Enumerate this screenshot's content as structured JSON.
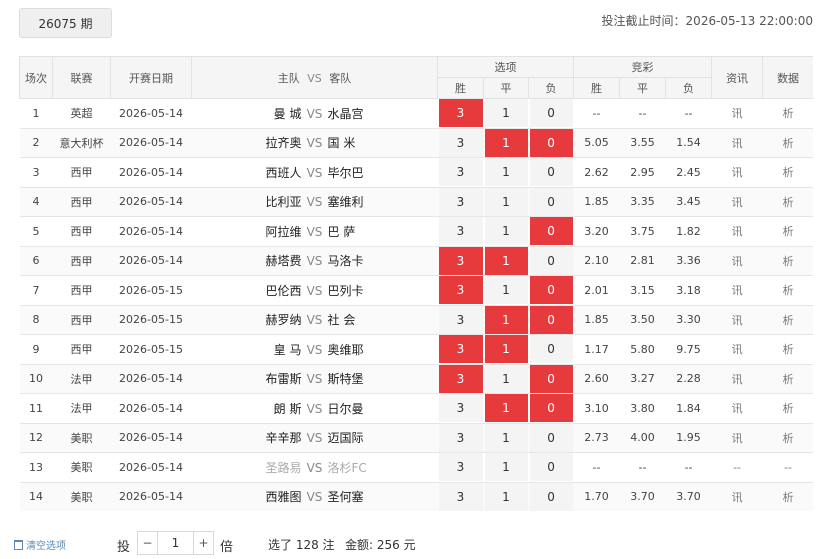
{
  "issue": "26075 期",
  "deadline": "投注截止时间：2026-05-13 22:00:00",
  "headers": {
    "no": "场次",
    "league": "联赛",
    "date": "开赛日期",
    "home": "主队",
    "vs": "VS",
    "away": "客队",
    "options": "选项",
    "odds": "竞彩",
    "win": "胜",
    "draw": "平",
    "lose": "负",
    "info": "资讯",
    "data": "数据"
  },
  "rows": [
    {
      "no": "1",
      "league": "英超",
      "date": "2026-05-14",
      "home": "曼 城",
      "away": "水晶宫",
      "p": [
        "3",
        "1",
        "0"
      ],
      "sel": [
        true,
        false,
        false
      ],
      "odds": [
        "--",
        "--",
        "--"
      ],
      "info": "讯",
      "data": "析",
      "disabled": false
    },
    {
      "no": "2",
      "league": "意大利杯",
      "date": "2026-05-14",
      "home": "拉齐奥",
      "away": "国 米",
      "p": [
        "3",
        "1",
        "0"
      ],
      "sel": [
        false,
        true,
        true
      ],
      "odds": [
        "5.05",
        "3.55",
        "1.54"
      ],
      "info": "讯",
      "data": "析",
      "disabled": false
    },
    {
      "no": "3",
      "league": "西甲",
      "date": "2026-05-14",
      "home": "西班人",
      "away": "毕尔巴",
      "p": [
        "3",
        "1",
        "0"
      ],
      "sel": [
        false,
        false,
        false
      ],
      "odds": [
        "2.62",
        "2.95",
        "2.45"
      ],
      "info": "讯",
      "data": "析",
      "disabled": false
    },
    {
      "no": "4",
      "league": "西甲",
      "date": "2026-05-14",
      "home": "比利亚",
      "away": "塞维利",
      "p": [
        "3",
        "1",
        "0"
      ],
      "sel": [
        false,
        false,
        false
      ],
      "odds": [
        "1.85",
        "3.35",
        "3.45"
      ],
      "info": "讯",
      "data": "析",
      "disabled": false
    },
    {
      "no": "5",
      "league": "西甲",
      "date": "2026-05-14",
      "home": "阿拉维",
      "away": "巴 萨",
      "p": [
        "3",
        "1",
        "0"
      ],
      "sel": [
        false,
        false,
        true
      ],
      "odds": [
        "3.20",
        "3.75",
        "1.82"
      ],
      "info": "讯",
      "data": "析",
      "disabled": false
    },
    {
      "no": "6",
      "league": "西甲",
      "date": "2026-05-14",
      "home": "赫塔费",
      "away": "马洛卡",
      "p": [
        "3",
        "1",
        "0"
      ],
      "sel": [
        true,
        true,
        false
      ],
      "odds": [
        "2.10",
        "2.81",
        "3.36"
      ],
      "info": "讯",
      "data": "析",
      "disabled": false
    },
    {
      "no": "7",
      "league": "西甲",
      "date": "2026-05-15",
      "home": "巴伦西",
      "away": "巴列卡",
      "p": [
        "3",
        "1",
        "0"
      ],
      "sel": [
        true,
        false,
        true
      ],
      "odds": [
        "2.01",
        "3.15",
        "3.18"
      ],
      "info": "讯",
      "data": "析",
      "disabled": false
    },
    {
      "no": "8",
      "league": "西甲",
      "date": "2026-05-15",
      "home": "赫罗纳",
      "away": "社 会",
      "p": [
        "3",
        "1",
        "0"
      ],
      "sel": [
        false,
        true,
        true
      ],
      "odds": [
        "1.85",
        "3.50",
        "3.30"
      ],
      "info": "讯",
      "data": "析",
      "disabled": false
    },
    {
      "no": "9",
      "league": "西甲",
      "date": "2026-05-15",
      "home": "皇 马",
      "away": "奥维耶",
      "p": [
        "3",
        "1",
        "0"
      ],
      "sel": [
        true,
        true,
        false
      ],
      "odds": [
        "1.17",
        "5.80",
        "9.75"
      ],
      "info": "讯",
      "data": "析",
      "disabled": false
    },
    {
      "no": "10",
      "league": "法甲",
      "date": "2026-05-14",
      "home": "布雷斯",
      "away": "斯特堡",
      "p": [
        "3",
        "1",
        "0"
      ],
      "sel": [
        true,
        false,
        true
      ],
      "odds": [
        "2.60",
        "3.27",
        "2.28"
      ],
      "info": "讯",
      "data": "析",
      "disabled": false
    },
    {
      "no": "11",
      "league": "法甲",
      "date": "2026-05-14",
      "home": "朗 斯",
      "away": "日尔曼",
      "p": [
        "3",
        "1",
        "0"
      ],
      "sel": [
        false,
        true,
        true
      ],
      "odds": [
        "3.10",
        "3.80",
        "1.84"
      ],
      "info": "讯",
      "data": "析",
      "disabled": false
    },
    {
      "no": "12",
      "league": "美职",
      "date": "2026-05-14",
      "home": "辛辛那",
      "away": "迈国际",
      "p": [
        "3",
        "1",
        "0"
      ],
      "sel": [
        false,
        false,
        false
      ],
      "odds": [
        "2.73",
        "4.00",
        "1.95"
      ],
      "info": "讯",
      "data": "析",
      "disabled": false
    },
    {
      "no": "13",
      "league": "美职",
      "date": "2026-05-14",
      "home": "圣路易",
      "away": "洛杉FC",
      "p": [
        "3",
        "1",
        "0"
      ],
      "sel": [
        false,
        false,
        false
      ],
      "odds": [
        "--",
        "--",
        "--"
      ],
      "info": "--",
      "data": "--",
      "disabled": true
    },
    {
      "no": "14",
      "league": "美职",
      "date": "2026-05-14",
      "home": "西雅图",
      "away": "圣何塞",
      "p": [
        "3",
        "1",
        "0"
      ],
      "sel": [
        false,
        false,
        false
      ],
      "odds": [
        "1.70",
        "3.70",
        "3.70"
      ],
      "info": "讯",
      "data": "析",
      "disabled": false
    }
  ],
  "footer": {
    "clear_label": "清空选项",
    "bet_label": "投",
    "minus": "−",
    "multiple": "1",
    "plus": "+",
    "multiple_unit": "倍",
    "selected": "选了 128 注",
    "amount": "金额:  256 元"
  },
  "colors": {
    "selected": "#e63a3d",
    "header_bg": "#f5f5f5",
    "link": "#5a8bb5"
  }
}
